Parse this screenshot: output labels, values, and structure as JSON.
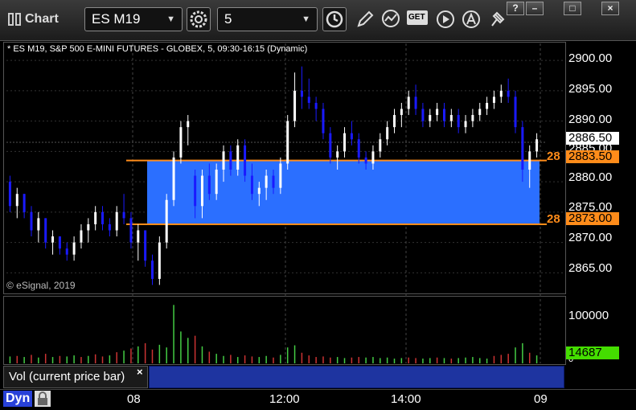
{
  "window": {
    "title": "Chart"
  },
  "toolbar": {
    "symbol": "ES M19",
    "interval": "5",
    "get_label": "GET"
  },
  "chart": {
    "info": "* ES M19, S&P 500 E-MINI FUTURES - GLOBEX, 5, 09:30-16:15 (Dynamic)",
    "copyright": "© eSignal, 2019",
    "price_axis_labels": [
      "2900.00",
      "2895.00",
      "2890.00",
      "2885.00",
      "2880.00",
      "2875.00",
      "2870.00",
      "2865.00"
    ],
    "current_price_tag": "2886.50",
    "zone_top_tag": "2883.50",
    "zone_bottom_tag": "2873.00",
    "zone_top_edge_label": "28",
    "zone_bottom_edge_label": "28",
    "volume_axis_label": "100000",
    "volume_zero_label": "0",
    "volume_tag": "14687",
    "study_label": "Vol (current price bar)",
    "study_close": "×",
    "time_labels": [
      "08",
      "12:00",
      "14:00",
      "09"
    ],
    "dyn_label": "Dyn",
    "colors": {
      "up_bar": "#ffffff",
      "down_bar": "#1a1aff",
      "zone_fill": "#2b6fff",
      "zone_line": "#ff8c1a",
      "volume_up": "#44cc44",
      "volume_down": "#cc3333",
      "volume_tag": "#44dd00"
    }
  },
  "chart_data": {
    "type": "candlestick",
    "symbol": "ES M19",
    "interval": "5",
    "price_axis": {
      "min": 2862,
      "max": 2902,
      "ticks": [
        2865,
        2870,
        2875,
        2880,
        2885,
        2890,
        2895,
        2900
      ]
    },
    "zone": {
      "top": 2883.5,
      "bottom": 2873.0
    },
    "current_price": 2886.5,
    "bars": [
      {
        "o": 2880,
        "h": 2881,
        "l": 2875,
        "c": 2876
      },
      {
        "o": 2876,
        "h": 2879,
        "l": 2874,
        "c": 2878
      },
      {
        "o": 2878,
        "h": 2878,
        "l": 2874,
        "c": 2875
      },
      {
        "o": 2875,
        "h": 2876,
        "l": 2871,
        "c": 2872
      },
      {
        "o": 2872,
        "h": 2875,
        "l": 2870,
        "c": 2874
      },
      {
        "o": 2874,
        "h": 2874,
        "l": 2869,
        "c": 2870
      },
      {
        "o": 2870,
        "h": 2872,
        "l": 2868,
        "c": 2871
      },
      {
        "o": 2871,
        "h": 2871,
        "l": 2868,
        "c": 2869
      },
      {
        "o": 2869,
        "h": 2870,
        "l": 2867,
        "c": 2868
      },
      {
        "o": 2868,
        "h": 2871,
        "l": 2867,
        "c": 2870
      },
      {
        "o": 2870,
        "h": 2873,
        "l": 2869,
        "c": 2872
      },
      {
        "o": 2872,
        "h": 2874,
        "l": 2870,
        "c": 2873
      },
      {
        "o": 2873,
        "h": 2876,
        "l": 2872,
        "c": 2875
      },
      {
        "o": 2875,
        "h": 2876,
        "l": 2872,
        "c": 2873
      },
      {
        "o": 2873,
        "h": 2874,
        "l": 2871,
        "c": 2872
      },
      {
        "o": 2872,
        "h": 2876,
        "l": 2871,
        "c": 2875
      },
      {
        "o": 2875,
        "h": 2878,
        "l": 2873,
        "c": 2874
      },
      {
        "o": 2874,
        "h": 2875,
        "l": 2869,
        "c": 2870
      },
      {
        "o": 2870,
        "h": 2873,
        "l": 2867,
        "c": 2872
      },
      {
        "o": 2872,
        "h": 2872,
        "l": 2866,
        "c": 2867
      },
      {
        "o": 2867,
        "h": 2868,
        "l": 2863,
        "c": 2864
      },
      {
        "o": 2864,
        "h": 2871,
        "l": 2863,
        "c": 2870
      },
      {
        "o": 2870,
        "h": 2878,
        "l": 2869,
        "c": 2877
      },
      {
        "o": 2877,
        "h": 2885,
        "l": 2876,
        "c": 2884
      },
      {
        "o": 2884,
        "h": 2890,
        "l": 2883,
        "c": 2889
      },
      {
        "o": 2889,
        "h": 2891,
        "l": 2886,
        "c": 2890
      },
      {
        "o": 2881,
        "h": 2882,
        "l": 2874,
        "c": 2876
      },
      {
        "o": 2876,
        "h": 2882,
        "l": 2874,
        "c": 2881
      },
      {
        "o": 2881,
        "h": 2883,
        "l": 2877,
        "c": 2878
      },
      {
        "o": 2878,
        "h": 2883,
        "l": 2877,
        "c": 2882
      },
      {
        "o": 2882,
        "h": 2886,
        "l": 2880,
        "c": 2885
      },
      {
        "o": 2885,
        "h": 2886,
        "l": 2881,
        "c": 2882
      },
      {
        "o": 2882,
        "h": 2887,
        "l": 2881,
        "c": 2886
      },
      {
        "o": 2886,
        "h": 2887,
        "l": 2880,
        "c": 2881
      },
      {
        "o": 2881,
        "h": 2883,
        "l": 2877,
        "c": 2878
      },
      {
        "o": 2878,
        "h": 2880,
        "l": 2876,
        "c": 2879
      },
      {
        "o": 2879,
        "h": 2882,
        "l": 2877,
        "c": 2881
      },
      {
        "o": 2881,
        "h": 2882,
        "l": 2878,
        "c": 2879
      },
      {
        "o": 2879,
        "h": 2884,
        "l": 2878,
        "c": 2883
      },
      {
        "o": 2883,
        "h": 2891,
        "l": 2882,
        "c": 2890
      },
      {
        "o": 2890,
        "h": 2898,
        "l": 2889,
        "c": 2895
      },
      {
        "o": 2895,
        "h": 2899,
        "l": 2892,
        "c": 2894
      },
      {
        "o": 2894,
        "h": 2897,
        "l": 2892,
        "c": 2893
      },
      {
        "o": 2893,
        "h": 2894,
        "l": 2890,
        "c": 2892
      },
      {
        "o": 2892,
        "h": 2893,
        "l": 2887,
        "c": 2888
      },
      {
        "o": 2888,
        "h": 2889,
        "l": 2883,
        "c": 2884
      },
      {
        "o": 2884,
        "h": 2886,
        "l": 2882,
        "c": 2885
      },
      {
        "o": 2885,
        "h": 2889,
        "l": 2884,
        "c": 2888
      },
      {
        "o": 2888,
        "h": 2890,
        "l": 2886,
        "c": 2887
      },
      {
        "o": 2887,
        "h": 2888,
        "l": 2883,
        "c": 2884
      },
      {
        "o": 2884,
        "h": 2885,
        "l": 2882,
        "c": 2883
      },
      {
        "o": 2883,
        "h": 2886,
        "l": 2882,
        "c": 2885
      },
      {
        "o": 2885,
        "h": 2888,
        "l": 2884,
        "c": 2887
      },
      {
        "o": 2887,
        "h": 2890,
        "l": 2886,
        "c": 2889
      },
      {
        "o": 2889,
        "h": 2892,
        "l": 2888,
        "c": 2891
      },
      {
        "o": 2891,
        "h": 2893,
        "l": 2889,
        "c": 2892
      },
      {
        "o": 2892,
        "h": 2895,
        "l": 2891,
        "c": 2894
      },
      {
        "o": 2894,
        "h": 2896,
        "l": 2891,
        "c": 2892
      },
      {
        "o": 2892,
        "h": 2893,
        "l": 2889,
        "c": 2890
      },
      {
        "o": 2890,
        "h": 2892,
        "l": 2889,
        "c": 2891
      },
      {
        "o": 2891,
        "h": 2893,
        "l": 2890,
        "c": 2892
      },
      {
        "o": 2892,
        "h": 2893,
        "l": 2889,
        "c": 2890
      },
      {
        "o": 2890,
        "h": 2892,
        "l": 2889,
        "c": 2891
      },
      {
        "o": 2891,
        "h": 2892,
        "l": 2888,
        "c": 2889
      },
      {
        "o": 2889,
        "h": 2891,
        "l": 2888,
        "c": 2890
      },
      {
        "o": 2890,
        "h": 2892,
        "l": 2889,
        "c": 2891
      },
      {
        "o": 2891,
        "h": 2893,
        "l": 2890,
        "c": 2892
      },
      {
        "o": 2892,
        "h": 2894,
        "l": 2891,
        "c": 2893
      },
      {
        "o": 2893,
        "h": 2895,
        "l": 2892,
        "c": 2894
      },
      {
        "o": 2894,
        "h": 2896,
        "l": 2893,
        "c": 2895
      },
      {
        "o": 2895,
        "h": 2897,
        "l": 2893,
        "c": 2894
      },
      {
        "o": 2894,
        "h": 2895,
        "l": 2888,
        "c": 2889
      },
      {
        "o": 2889,
        "h": 2890,
        "l": 2880,
        "c": 2882
      },
      {
        "o": 2882,
        "h": 2886,
        "l": 2879,
        "c": 2885
      },
      {
        "o": 2885,
        "h": 2888,
        "l": 2884,
        "c": 2887
      }
    ],
    "volume": {
      "axis_label": 100000,
      "current": 14687,
      "values": [
        13000,
        14000,
        12000,
        16000,
        11000,
        18000,
        12000,
        14000,
        13000,
        15000,
        12000,
        14000,
        17000,
        13000,
        15000,
        21000,
        24000,
        28000,
        32000,
        38000,
        26000,
        35000,
        30000,
        110000,
        60000,
        48000,
        52000,
        32000,
        22000,
        18000,
        14000,
        16000,
        12000,
        15000,
        13000,
        12000,
        14000,
        11000,
        16000,
        30000,
        34000,
        20000,
        15000,
        12000,
        13000,
        11000,
        12000,
        10000,
        11000,
        12000,
        11000,
        12000,
        10000,
        11000,
        9000,
        10000,
        11000,
        10000,
        9000,
        10000,
        11000,
        10000,
        9000,
        10000,
        11000,
        12000,
        10000,
        9000,
        14000,
        16000,
        18000,
        30000,
        38000,
        20000,
        15000
      ],
      "up": [
        true,
        false,
        true,
        false,
        true,
        false,
        true,
        false,
        true,
        true,
        false,
        true,
        false,
        false,
        true,
        false,
        true,
        false,
        true,
        false,
        false,
        true,
        true,
        true,
        true,
        true,
        false,
        true,
        false,
        true,
        true,
        false,
        true,
        false,
        false,
        true,
        true,
        false,
        true,
        true,
        true,
        false,
        false,
        false,
        false,
        false,
        true,
        true,
        false,
        false,
        true,
        true,
        true,
        true,
        true,
        true,
        false,
        false,
        true,
        true,
        false,
        true,
        false,
        true,
        true,
        true,
        true,
        true,
        false,
        false,
        false,
        true,
        true,
        false,
        true
      ]
    },
    "time_axis": {
      "labels": [
        "08",
        "12:00",
        "14:00",
        "09"
      ]
    }
  }
}
